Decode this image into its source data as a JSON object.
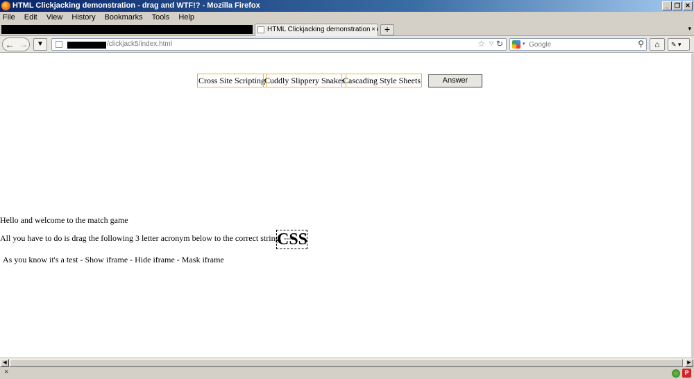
{
  "window": {
    "title": "HTML Clickjacking demonstration - drag and WTF!? - Mozilla Firefox",
    "controls": [
      "_",
      "❐",
      "✕"
    ]
  },
  "menu": [
    "File",
    "Edit",
    "View",
    "History",
    "Bookmarks",
    "Tools",
    "Help"
  ],
  "tabs": {
    "active_label": "HTML Clickjacking demonstration - drag a...",
    "close": "×",
    "new_tab": "+",
    "list_dropdown": "▾"
  },
  "nav": {
    "url_suffix": "/clickjack5/index.html",
    "search_placeholder": "Google",
    "search_engine_dropdown": "▾"
  },
  "content": {
    "choices": [
      "Cross Site Scripting",
      "Cuddly Slippery Snakes",
      "Cascading Style Sheets"
    ],
    "answer_label": "Answer",
    "welcome": "Hello and welcome to the match game",
    "instruction": "All you have to do is drag the following 3 letter acronym below to the correct string. --->",
    "acronym": "CSS",
    "test_line": "As you know it's a test - Show iframe - Hide iframe - Mask iframe"
  },
  "statusbar": {
    "close": "×",
    "addon_badge": "P"
  },
  "colors": {
    "choice_border": "#f0b030",
    "title_gradient_start": "#0a246a",
    "chrome_bg": "#d4d0c8"
  },
  "icons": [
    "firefox-logo-icon",
    "back-icon",
    "forward-icon",
    "download-icon",
    "bookmark-star-icon",
    "reload-icon",
    "google-icon",
    "search-go-icon",
    "home-icon",
    "addon-icon",
    "status-globe-icon",
    "status-addon-icon"
  ]
}
